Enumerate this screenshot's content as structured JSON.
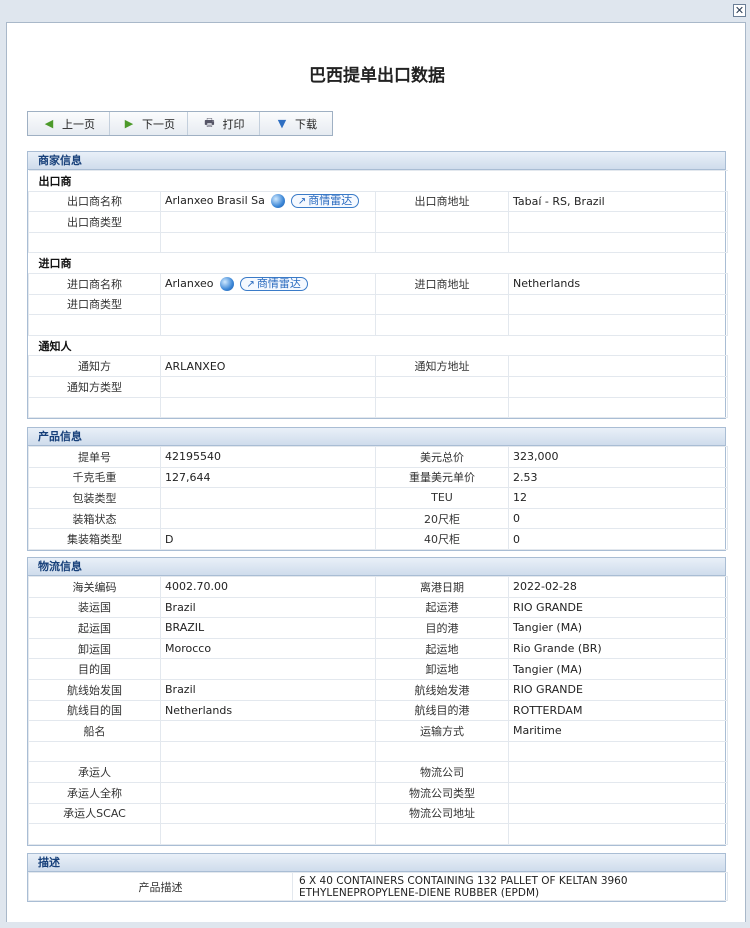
{
  "window": {
    "close_label": "✕"
  },
  "title": "巴西提单出口数据",
  "toolbar": [
    {
      "label": "上一页",
      "icon": "arrow-left-icon",
      "glyph": "◀"
    },
    {
      "label": "下一页",
      "icon": "arrow-right-icon",
      "glyph": "▶"
    },
    {
      "label": "打印",
      "icon": "printer-icon",
      "glyph": "🖶"
    },
    {
      "label": "下载",
      "icon": "download-icon",
      "glyph": "▼"
    }
  ],
  "colors": {
    "section_head_text": "#17407a",
    "globe": "#3b86d6",
    "radar_border": "#3a7bc8"
  },
  "merchant": {
    "header": "商家信息",
    "radar_label": "商情雷达",
    "exporter": {
      "group": "出口商",
      "name_label": "出口商名称",
      "name": "Arlanxeo Brasil Sa",
      "addr_label": "出口商地址",
      "addr": "Tabaí - RS, Brazil",
      "type_label": "出口商类型",
      "type": ""
    },
    "importer": {
      "group": "进口商",
      "name_label": "进口商名称",
      "name": "Arlanxeo",
      "addr_label": "进口商地址",
      "addr": "Netherlands",
      "type_label": "进口商类型",
      "type": ""
    },
    "notify": {
      "group": "通知人",
      "name_label": "通知方",
      "name": "ARLANXEO",
      "addr_label": "通知方地址",
      "addr": "",
      "type_label": "通知方类型",
      "type": ""
    }
  },
  "product": {
    "header": "产品信息",
    "rows": [
      {
        "l1": "提单号",
        "v1": "42195540",
        "l2": "美元总价",
        "v2": "323,000"
      },
      {
        "l1": "千克毛重",
        "v1": "127,644",
        "l2": "重量美元单价",
        "v2": "2.53"
      },
      {
        "l1": "包装类型",
        "v1": "",
        "l2": "TEU",
        "v2": "12"
      },
      {
        "l1": "装箱状态",
        "v1": "",
        "l2": "20尺柜",
        "v2": "0"
      },
      {
        "l1": "集装箱类型",
        "v1": "D",
        "l2": "40尺柜",
        "v2": "0"
      }
    ]
  },
  "logistics": {
    "header": "物流信息",
    "rows": [
      {
        "l1": "海关编码",
        "v1": "4002.70.00",
        "l2": "离港日期",
        "v2": "2022-02-28"
      },
      {
        "l1": "装运国",
        "v1": "Brazil",
        "l2": "起运港",
        "v2": "RIO GRANDE"
      },
      {
        "l1": "起运国",
        "v1": "BRAZIL",
        "l2": "目的港",
        "v2": "Tangier (MA)"
      },
      {
        "l1": "卸运国",
        "v1": "Morocco",
        "l2": "起运地",
        "v2": "Rio Grande (BR)"
      },
      {
        "l1": "目的国",
        "v1": "",
        "l2": "卸运地",
        "v2": "Tangier (MA)"
      },
      {
        "l1": "航线始发国",
        "v1": "Brazil",
        "l2": "航线始发港",
        "v2": "RIO GRANDE"
      },
      {
        "l1": "航线目的国",
        "v1": "Netherlands",
        "l2": "航线目的港",
        "v2": "ROTTERDAM"
      },
      {
        "l1": "船名",
        "v1": "",
        "l2": "运输方式",
        "v2": "Maritime"
      },
      {
        "l1": "",
        "v1": "",
        "l2": "",
        "v2": ""
      },
      {
        "l1": "承运人",
        "v1": "",
        "l2": "物流公司",
        "v2": ""
      },
      {
        "l1": "承运人全称",
        "v1": "",
        "l2": "物流公司类型",
        "v2": ""
      },
      {
        "l1": "承运人SCAC",
        "v1": "",
        "l2": "物流公司地址",
        "v2": ""
      },
      {
        "l1": "",
        "v1": "",
        "l2": "",
        "v2": ""
      }
    ]
  },
  "description": {
    "header": "描述",
    "label": "产品描述",
    "value": "6 X 40 CONTAINERS CONTAINING 132 PALLET OF KELTAN 3960 ETHYLENEPROPYLENE-DIENE RUBBER (EPDM)"
  }
}
